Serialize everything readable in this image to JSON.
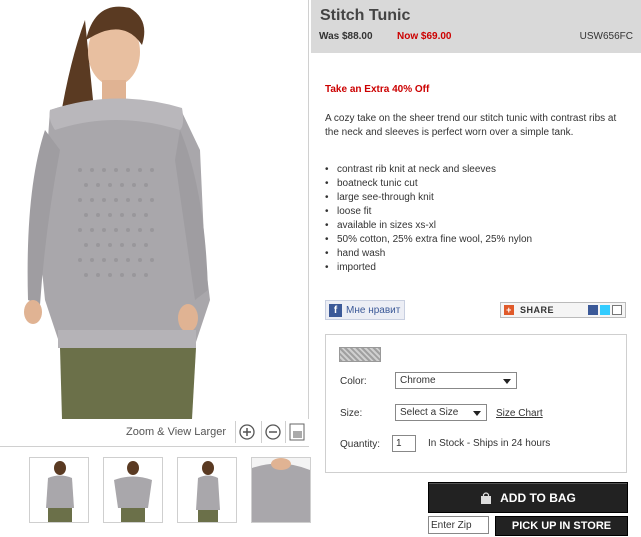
{
  "product": {
    "title": "Stitch Tunic",
    "price_was": "Was $88.00",
    "price_now": "Now $69.00",
    "sku": "USW656FC",
    "promo": "Take an Extra 40% Off",
    "description": "A cozy take on the sheer trend our stitch tunic with contrast ribs at the neck and sleeves is perfect worn over a simple tank.",
    "features": [
      "contrast rib knit at neck and sleeves",
      "boatneck tunic cut",
      "large see-through knit",
      "loose fit",
      "available in sizes xs-xl",
      "50% cotton, 25% extra fine wool, 25% nylon",
      "hand wash",
      "imported"
    ]
  },
  "zoom": {
    "label": "Zoom & View Larger"
  },
  "social": {
    "fb_like": "Мне нравит",
    "share": "SHARE"
  },
  "options": {
    "color_label": "Color:",
    "color_value": "Chrome",
    "size_label": "Size:",
    "size_value": "Select a Size",
    "size_chart": "Size Chart",
    "quantity_label": "Quantity:",
    "quantity_value": "1",
    "stock": "In Stock - Ships in 24 hours"
  },
  "actions": {
    "add_to_bag": "ADD TO BAG",
    "zip_placeholder": "Enter Zip",
    "pickup": "PICK UP IN STORE"
  },
  "colors": {
    "price_now": "#cc0000",
    "header_bg": "#d9d9d9",
    "button_bg": "#222222",
    "sweater": "#a9a7ab"
  }
}
